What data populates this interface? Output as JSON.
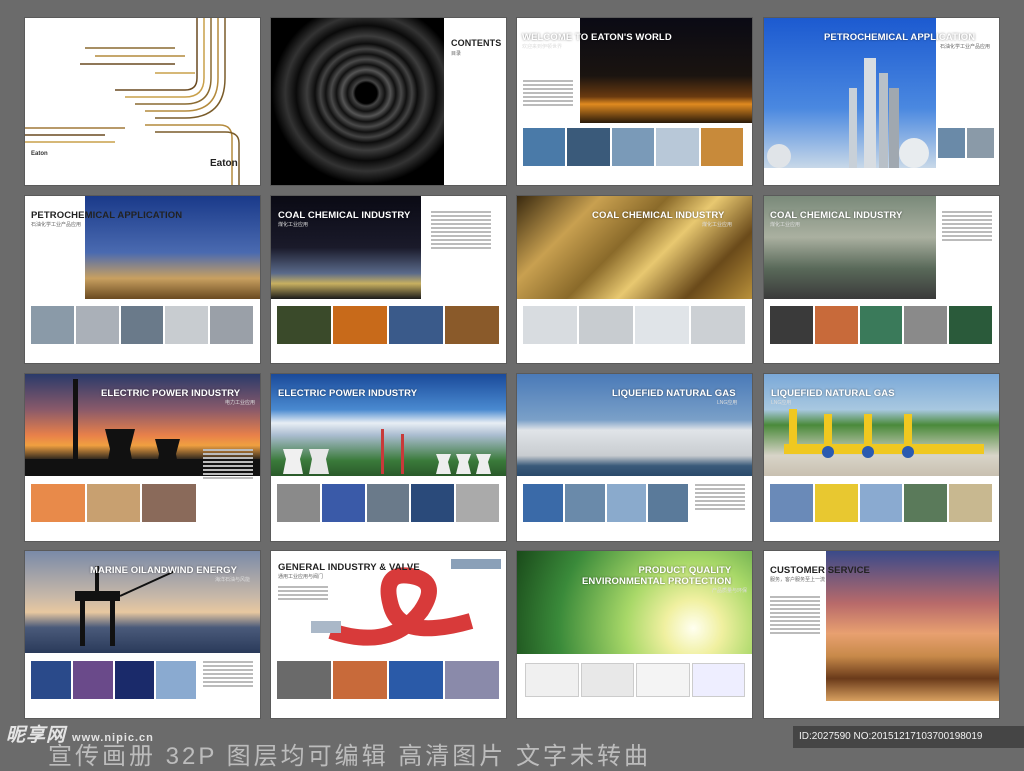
{
  "cover": {
    "brand": "Eaton",
    "brand_small": "Eaton"
  },
  "contents": {
    "title": "CONTENTS",
    "subtitle": "目录"
  },
  "spreads": [
    {
      "title": "WELCOME TO EATON'S WORLD",
      "subtitle": "欢迎来到伊顿世界"
    },
    {
      "title": "PETROCHEMICAL   APPLICATION",
      "subtitle": "石油化学工业产品应用"
    },
    {
      "title": "PETROCHEMICAL  APPLICATION",
      "subtitle": "石油化学工业产品应用"
    },
    {
      "title": "COAL CHEMICAL INDUSTRY",
      "subtitle": "煤化工业应用"
    },
    {
      "title": "COAL CHEMICAL INDUSTRY",
      "subtitle": "煤化工业应用"
    },
    {
      "title": "COAL CHEMICAL INDUSTRY",
      "subtitle": "煤化工业应用"
    },
    {
      "title": "ELECTRIC POWER INDUSTRY",
      "subtitle": "电力工业应用"
    },
    {
      "title": "ELECTRIC POWER INDUSTRY",
      "subtitle": "电力工业应用"
    },
    {
      "title": "LIQUEFIED NATURAL GAS",
      "subtitle": "LNG应用"
    },
    {
      "title": "LIQUEFIED NATURAL GAS",
      "subtitle": "LNG应用"
    },
    {
      "title": "MARINE OILANDWIND ENERGY",
      "subtitle": "海洋石油与风能"
    },
    {
      "title": "GENERAL INDUSTRY & VALVE",
      "subtitle": "通用工业应用与阀门"
    },
    {
      "title": "PRODUCT QUALITY\nENVIRONMENTAL PROTECTION",
      "subtitle": "产品质量与环保"
    },
    {
      "title": "CUSTOMER SERVICE",
      "subtitle": "服务，客户服务至上一流"
    }
  ],
  "watermark": {
    "site": "昵享网",
    "url": "www.nipic.cn"
  },
  "bottom_caption": "宣传画册  32P   图层均可编辑   高清图片   文字未转曲",
  "id_label": "ID:2027590 NO:20151217103700198019"
}
